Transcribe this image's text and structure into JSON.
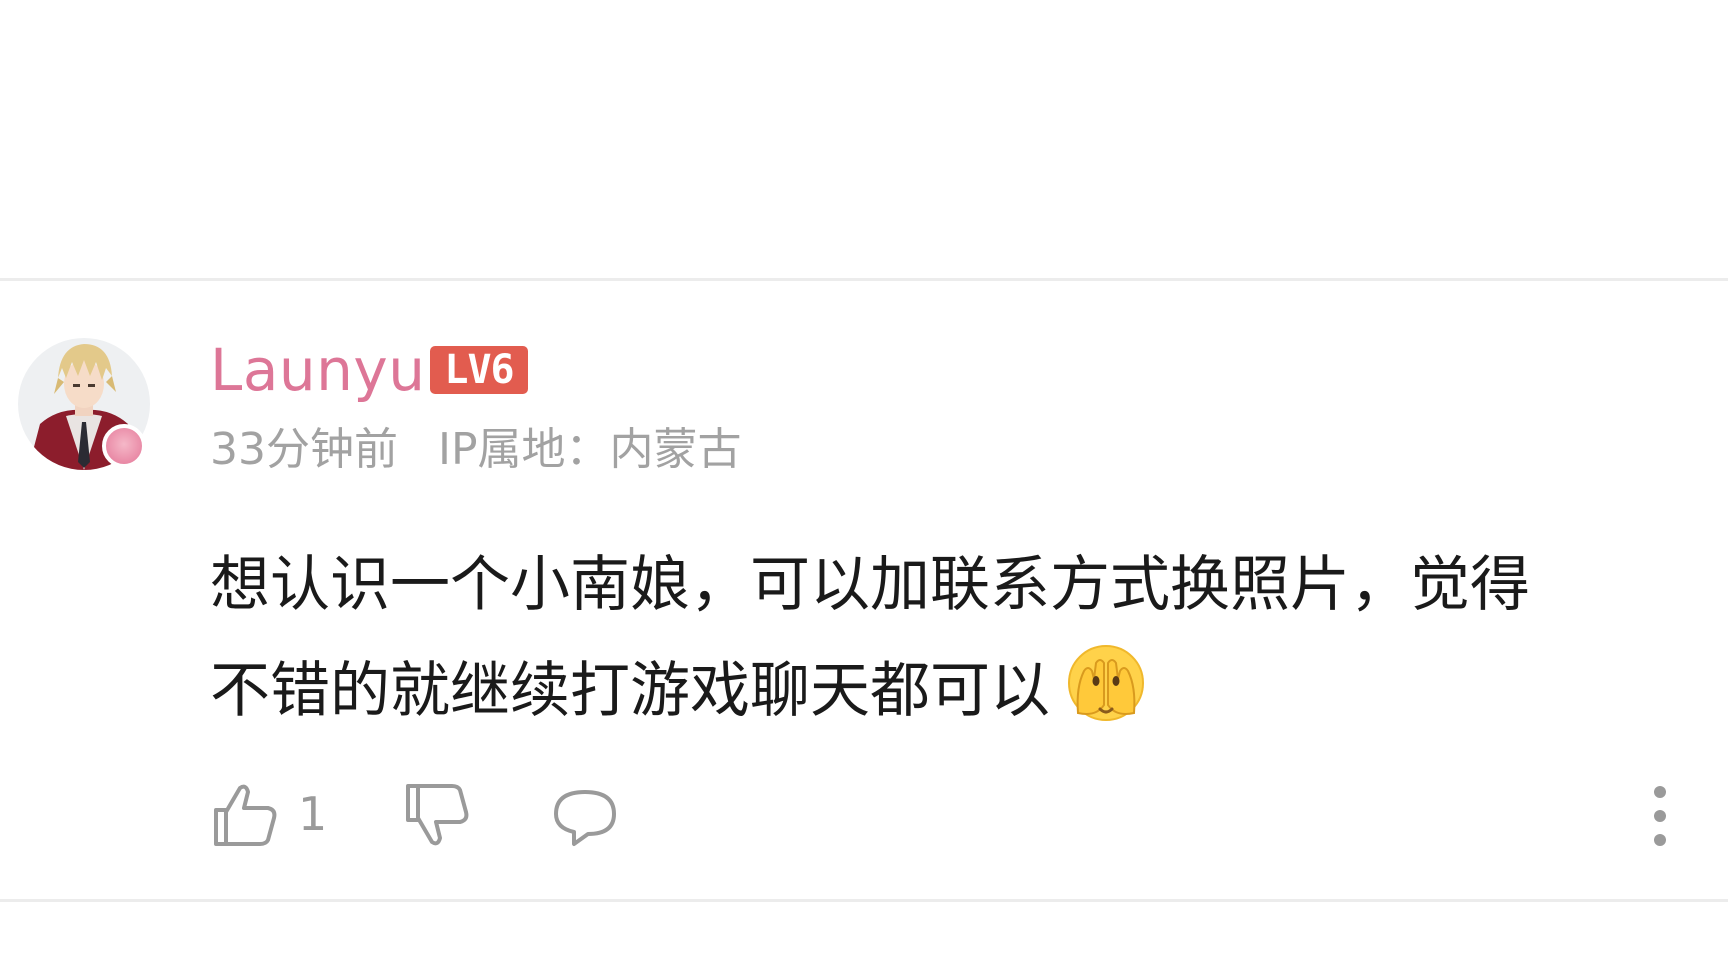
{
  "comment": {
    "user": {
      "name": "Launyu",
      "level": "LV6",
      "avatar": "avatar-anime-character",
      "name_color": "#dd7697"
    },
    "meta": {
      "time": "33分钟前",
      "ip_location": "IP属地：内蒙古"
    },
    "text": {
      "line1": "想认识一个小南娘，可以加联系方式换照片，觉得",
      "line2": "不错的就继续打游戏聊天都可以"
    },
    "emoji": "face-with-hands-over-eyes-emoji",
    "actions": {
      "like_icon": "thumbs-up-icon",
      "like_count": "1",
      "dislike_icon": "thumbs-down-icon",
      "reply_icon": "comment-bubble-icon",
      "more_icon": "more-vertical-icon"
    },
    "colors": {
      "level_badge": "#e25c4f",
      "meta_text": "#a2a2a2",
      "icon_gray": "#9a9a9a"
    }
  }
}
